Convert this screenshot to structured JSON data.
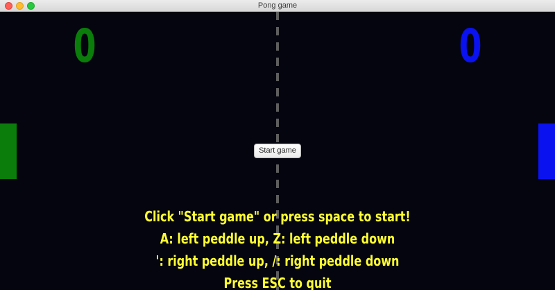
{
  "window": {
    "title": "Pong game"
  },
  "colors": {
    "background": "#05050f",
    "left_player": "#0a7d0a",
    "right_player": "#0a12f0",
    "center_line": "#5e5e5e",
    "instructions": "#ffff33"
  },
  "scores": {
    "left": "0",
    "right": "0"
  },
  "paddles": {
    "left_color": "#0a7d0a",
    "right_color": "#0a12f0"
  },
  "start_button": {
    "label": "Start game"
  },
  "instructions": [
    "Click \"Start game\" or press space to start!",
    "A: left peddle up, Z: left peddle down",
    "': right peddle up, /: right peddle down",
    "Press ESC to quit"
  ]
}
